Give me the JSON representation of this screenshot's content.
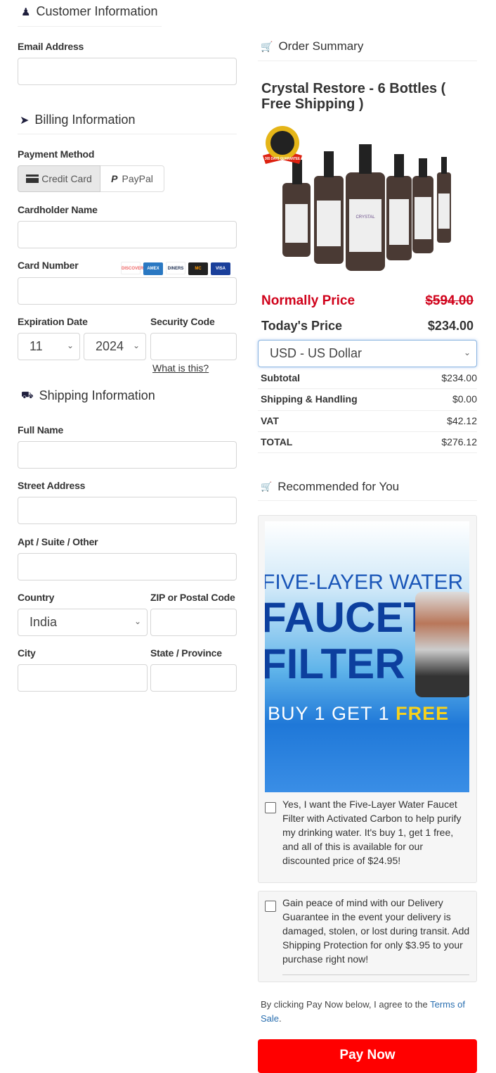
{
  "customer": {
    "title": "Customer Information",
    "email_label": "Email Address",
    "email_value": ""
  },
  "billing": {
    "title": "Billing Information",
    "payment_method_label": "Payment Method",
    "credit_card": "Credit Card",
    "paypal": "PayPal",
    "cardholder_label": "Cardholder Name",
    "card_number_label": "Card Number",
    "card_brands": [
      "DISCOVER",
      "AMEX",
      "DINERS",
      "MC",
      "VISA"
    ],
    "expiration_label": "Expiration Date",
    "security_label": "Security Code",
    "month": "11",
    "year": "2024",
    "what_is_this": "What is this?"
  },
  "shipping": {
    "title": "Shipping Information",
    "full_name_label": "Full Name",
    "street_label": "Street Address",
    "apt_label": "Apt / Suite / Other",
    "country_label": "Country",
    "country_value": "India",
    "zip_label": "ZIP or Postal Code",
    "city_label": "City",
    "state_label": "State / Province"
  },
  "order": {
    "title": "Order Summary",
    "product_title": "Crystal Restore - 6 Bottles ( Free Shipping )",
    "badge": "365 DAYS GUARANTEE",
    "brand": "CRYSTAL RESTORE",
    "normally_label": "Normally Price",
    "normally_value": "$594.00",
    "today_label": "Today's Price",
    "today_value": "$234.00",
    "currency": "USD - US Dollar",
    "rows": [
      {
        "k": "Subtotal",
        "v": "$234.00"
      },
      {
        "k": "Shipping & Handling",
        "v": "$0.00"
      },
      {
        "k": "VAT",
        "v": "$42.12"
      },
      {
        "k": "TOTAL",
        "v": "$276.12"
      }
    ]
  },
  "recommended": {
    "title": "Recommended for You",
    "banner": {
      "line1": "FIVE-LAYER WATER",
      "line2": "FAUCET",
      "line3": "FILTER",
      "line4a": "BUY 1 GET 1",
      "line4b": "FREE"
    },
    "offer_text": "Yes, I want the Five-Layer Water Faucet Filter with Activated Carbon to help purify my drinking water. It's buy 1, get 1 free, and all of this is available for our discounted price of $24.95!",
    "protection_text": "Gain peace of mind with our Delivery Guarantee in the event your delivery is damaged, stolen, or lost during transit. Add Shipping Protection for only $3.95 to your purchase right now!"
  },
  "terms": {
    "prefix": "By clicking Pay Now below, I agree to the ",
    "link": "Terms of Sale",
    "suffix": "."
  },
  "pay_now": "Pay Now",
  "colors": {
    "accent_red": "#ff0000",
    "price_red": "#d0021b",
    "link": "#2a6fb0",
    "icon_navy": "#1f1f3d"
  }
}
